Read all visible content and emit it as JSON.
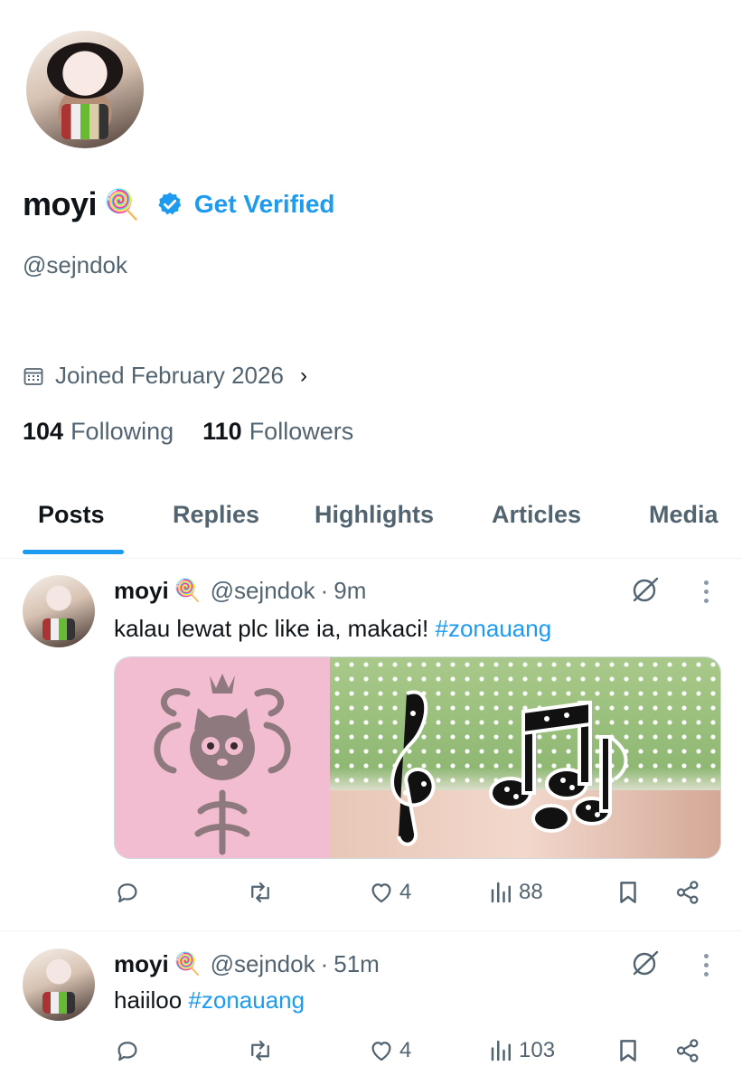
{
  "profile": {
    "display_name": "moyi",
    "emoji": "🍭",
    "get_verified_label": "Get Verified",
    "handle": "@sejndok",
    "joined": "Joined February 2026",
    "following_count": "104",
    "following_label": "Following",
    "followers_count": "110",
    "followers_label": "Followers"
  },
  "tabs": [
    {
      "label": "Posts",
      "active": true
    },
    {
      "label": "Replies",
      "active": false
    },
    {
      "label": "Highlights",
      "active": false
    },
    {
      "label": "Articles",
      "active": false
    },
    {
      "label": "Media",
      "active": false
    }
  ],
  "posts": [
    {
      "name": "moyi",
      "emoji": "🍭",
      "handle": "@sejndok",
      "time": "9m",
      "text": "kalau lewat plc like ia, makaci! ",
      "hashtag": "#zonauang",
      "likes": "4",
      "views": "88"
    },
    {
      "name": "moyi",
      "emoji": "🍭",
      "handle": "@sejndok",
      "time": "51m",
      "text": "haiiloo ",
      "hashtag": "#zonauang",
      "likes": "4",
      "views": "103"
    }
  ],
  "colors": {
    "accent": "#1d9bf0",
    "secondary_text": "#536471",
    "primary_text": "#0f1419"
  },
  "icons": [
    "calendar-icon",
    "verified-badge-icon",
    "grok-icon",
    "more-icon",
    "reply-icon",
    "repost-icon",
    "like-icon",
    "views-icon",
    "bookmark-icon",
    "share-icon"
  ]
}
